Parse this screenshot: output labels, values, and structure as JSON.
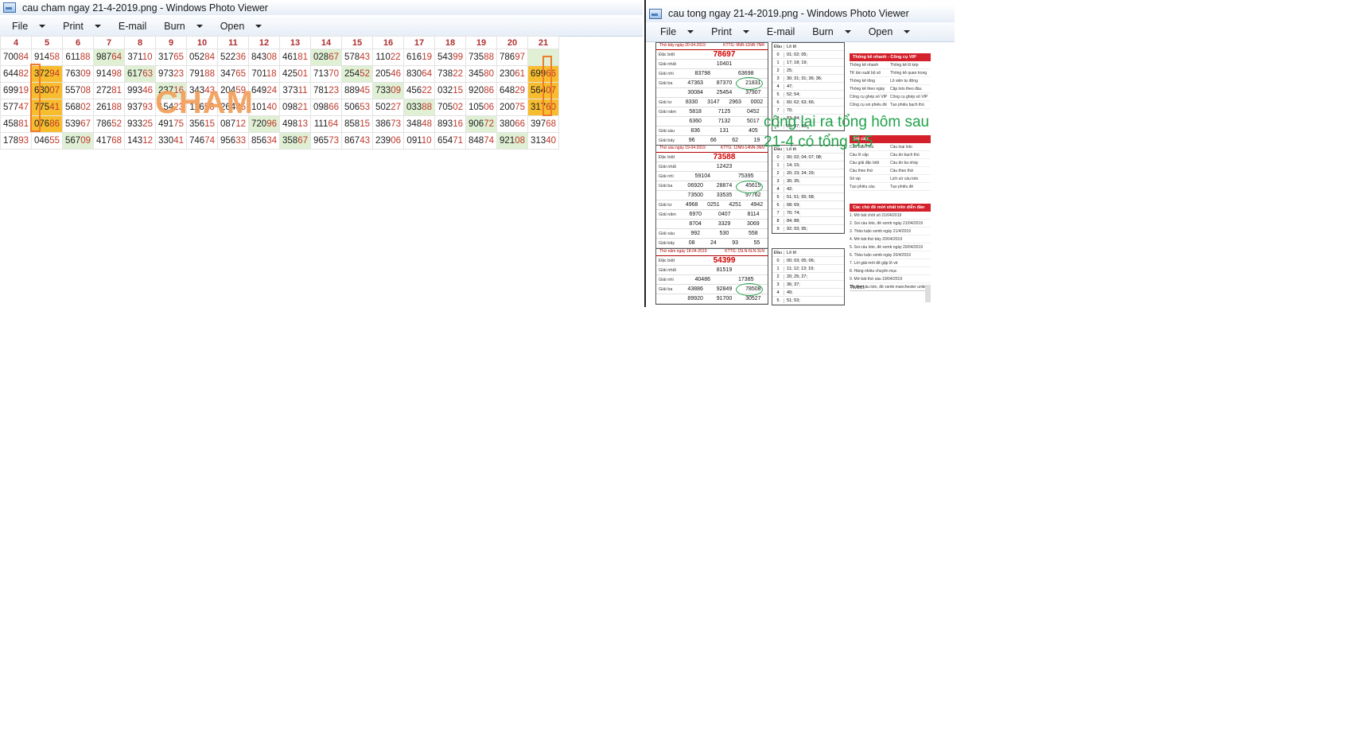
{
  "left_window": {
    "title": "cau cham ngay 21-4-2019.png - Windows Photo Viewer",
    "menus": [
      "File",
      "Print",
      "E-mail",
      "Burn",
      "Open"
    ],
    "columns": [
      "4",
      "5",
      "6",
      "7",
      "8",
      "9",
      "10",
      "11",
      "12",
      "13",
      "14",
      "15",
      "16",
      "17",
      "18",
      "19",
      "20",
      "21"
    ],
    "rows": [
      [
        "70084",
        "91458",
        "61188",
        "98764",
        "37110",
        "31765",
        "05284",
        "52236",
        "84308",
        "46181",
        "02867",
        "57843",
        "11022",
        "61619",
        "54399",
        "73588",
        "78697",
        ""
      ],
      [
        "64482",
        "37294",
        "76309",
        "91498",
        "61763",
        "97323",
        "79188",
        "34765",
        "70118",
        "42501",
        "71370",
        "25452",
        "20546",
        "83064",
        "73822",
        "34580",
        "23061",
        "69966"
      ],
      [
        "69919",
        "63007",
        "55708",
        "27281",
        "99346",
        "23716",
        "34343",
        "20459",
        "64924",
        "37311",
        "78123",
        "88945",
        "73309",
        "45622",
        "03215",
        "92086",
        "64829",
        "56407"
      ],
      [
        "57747",
        "77541",
        "56802",
        "26188",
        "93793",
        "15423",
        "11656",
        "26485",
        "10140",
        "09821",
        "09866",
        "50653",
        "50227",
        "03388",
        "70502",
        "10506",
        "20075",
        "31760"
      ],
      [
        "45881",
        "07686",
        "53967",
        "78652",
        "93325",
        "49175",
        "35615",
        "08712",
        "72096",
        "49813",
        "11164",
        "85815",
        "38673",
        "34848",
        "89316",
        "90672",
        "38066",
        "39768"
      ],
      [
        "17893",
        "04655",
        "56709",
        "41768",
        "14312",
        "33041",
        "74674",
        "95633",
        "85634",
        "35867",
        "96573",
        "86743",
        "23906",
        "09110",
        "65471",
        "84874",
        "92108",
        "31340"
      ]
    ],
    "overlay_text": "CHAM"
  },
  "right_window": {
    "title": "cau tong ngay 21-4-2019.png - Windows Photo Viewer",
    "menus": [
      "File",
      "Print",
      "E-mail",
      "Burn",
      "Open"
    ],
    "results": [
      {
        "header": "Thứ bảy ngày 20-04-2019",
        "code": "KTTG: 9NR-11NR-7NR",
        "db": "78697",
        "g1": [
          "10401"
        ],
        "g2": [
          "83798",
          "63698"
        ],
        "g3": [
          "47363",
          "87370",
          "21831",
          "30084",
          "25454",
          "37907"
        ],
        "g4": [
          "8330",
          "3147",
          "2963",
          "0002"
        ],
        "g5": [
          "5818",
          "7125",
          "0452",
          "6360",
          "7132",
          "5017"
        ],
        "g6": [
          "836",
          "131",
          "405"
        ],
        "g7": [
          "96",
          "66",
          "62",
          "19"
        ]
      },
      {
        "header": "Thứ sáu ngày 19-04-2019",
        "code": "KTTG: 12NN-14NN-3NN",
        "db": "73588",
        "g1": [
          "12423"
        ],
        "g2": [
          "59104",
          "75395"
        ],
        "g3": [
          "06920",
          "28874",
          "45615",
          "73500",
          "33535",
          "97762"
        ],
        "g4": [
          "4968",
          "0251",
          "4251",
          "4942"
        ],
        "g5": [
          "6970",
          "0407",
          "8114",
          "8704",
          "3329",
          "3069"
        ],
        "g6": [
          "992",
          "530",
          "558"
        ],
        "g7": [
          "08",
          "24",
          "93",
          "55"
        ]
      },
      {
        "header": "Thứ năm ngày 18-04-2019",
        "code": "KTTG: 15LN-5LN-3LN",
        "db": "54399",
        "g1": [
          "81519"
        ],
        "g2": [
          "40486",
          "17385"
        ],
        "g3": [
          "43886",
          "92849",
          "78508",
          "89920",
          "91700",
          "30527"
        ]
      }
    ],
    "labels": {
      "dac_biet": "Đặc biệt",
      "giai_nhat": "Giải nhất",
      "giai_nhi": "Giải nhì",
      "giai_ba": "Giải ba",
      "giai_tu": "Giải tư",
      "giai_nam": "Giải năm",
      "giai_sau": "Giải sáu",
      "giai_bay": "Giải bảy",
      "dau": "Đầu",
      "loto": "Lô tô"
    },
    "loto_1": [
      [
        "0",
        "01; 02; 05;"
      ],
      [
        "1",
        "17; 18; 19;"
      ],
      [
        "2",
        "25;"
      ],
      [
        "3",
        "30; 31; 31; 36; 36;"
      ],
      [
        "4",
        "47;"
      ],
      [
        "5",
        "52; 54;"
      ],
      [
        "6",
        "60; 62; 63; 66;"
      ],
      [
        "7",
        "70;"
      ],
      [
        "8",
        "83; 84;"
      ],
      [
        "9",
        "96; 97; 98;"
      ]
    ],
    "loto_2": [
      [
        "0",
        "00; 02; 04; 07; 08;"
      ],
      [
        "1",
        "14; 15;"
      ],
      [
        "2",
        "20; 23; 24; 29;"
      ],
      [
        "3",
        "30; 35;"
      ],
      [
        "4",
        "42;"
      ],
      [
        "5",
        "51; 51; 55; 58;"
      ],
      [
        "6",
        "68; 69;"
      ],
      [
        "7",
        "70; 74;"
      ],
      [
        "8",
        "84; 88;"
      ],
      [
        "9",
        "92; 93; 95;"
      ]
    ],
    "loto_3": [
      [
        "0",
        "00; 03; 05; 06;"
      ],
      [
        "1",
        "11; 12; 13; 19;"
      ],
      [
        "2",
        "20; 25; 27;"
      ],
      [
        "3",
        "36; 37;"
      ],
      [
        "4",
        "49;"
      ],
      [
        "5",
        "51; 53;"
      ]
    ],
    "sidebar": {
      "vip_header": "Thống kê nhanh - Công cụ VIP",
      "vip_rows": [
        [
          "Thống kê nhanh",
          "Thống kê lô kép"
        ],
        [
          "TK tần suất bộ số",
          "Thống kê quan trọng"
        ],
        [
          "Thống kê tổng",
          "Lô xiên tự động"
        ],
        [
          "Thống kê theo ngày",
          "Cặp loto theo đầu"
        ],
        [
          "Công cụ ghép số VIP",
          "Công cụ ghép số VIP"
        ],
        [
          "Công cụ soi phiếu đề",
          "Tạo phiếu bạch thủ"
        ]
      ],
      "cau_header": "Soi cầu",
      "cau_rows": [
        [
          "Cầu Bạch thủ",
          "Cầu loại loto"
        ],
        [
          "Cầu lô cặp",
          "Cầu ăn bạch thủ"
        ],
        [
          "Cầu giải đặc biệt",
          "Cầu ăn ba nháy"
        ],
        [
          "Cầu theo thứ",
          "Cầu theo thứ"
        ],
        [
          "Số vip",
          "Lịch sử cầu loto"
        ],
        [
          "Tạo phiếu cầu",
          "Tạo phiếu đề"
        ]
      ],
      "news_header": "Các chủ đề mới nhất trên diễn đàn",
      "news_rows": [
        "1. Mở bát chốt số 21/04/2019",
        "2. Soi cầu loto, đề xsmb ngày 21/04/2019",
        "3. Thảo luận xsmb ngày 21/4/2019",
        "4. Mở bát thứ bảy 20/04/2019",
        "5. Soi cầu loto, đề xsmb ngày 20/04/2019",
        "6. Thảo luận xsmb ngày 20/4/2019",
        "7. Lời giải mới để gặp lô về",
        "8. Hàng nhiều chuyên mục",
        "9. Mở bát thứ sáu 19/04/2019",
        "10. Soi cầu loto, đề xsmb manchester united"
      ],
      "tweet_label": "Tweet"
    },
    "note_line1": "cộng lại ra tổng hôm sau",
    "note_line2": "21-4 có tổng 5.5"
  }
}
